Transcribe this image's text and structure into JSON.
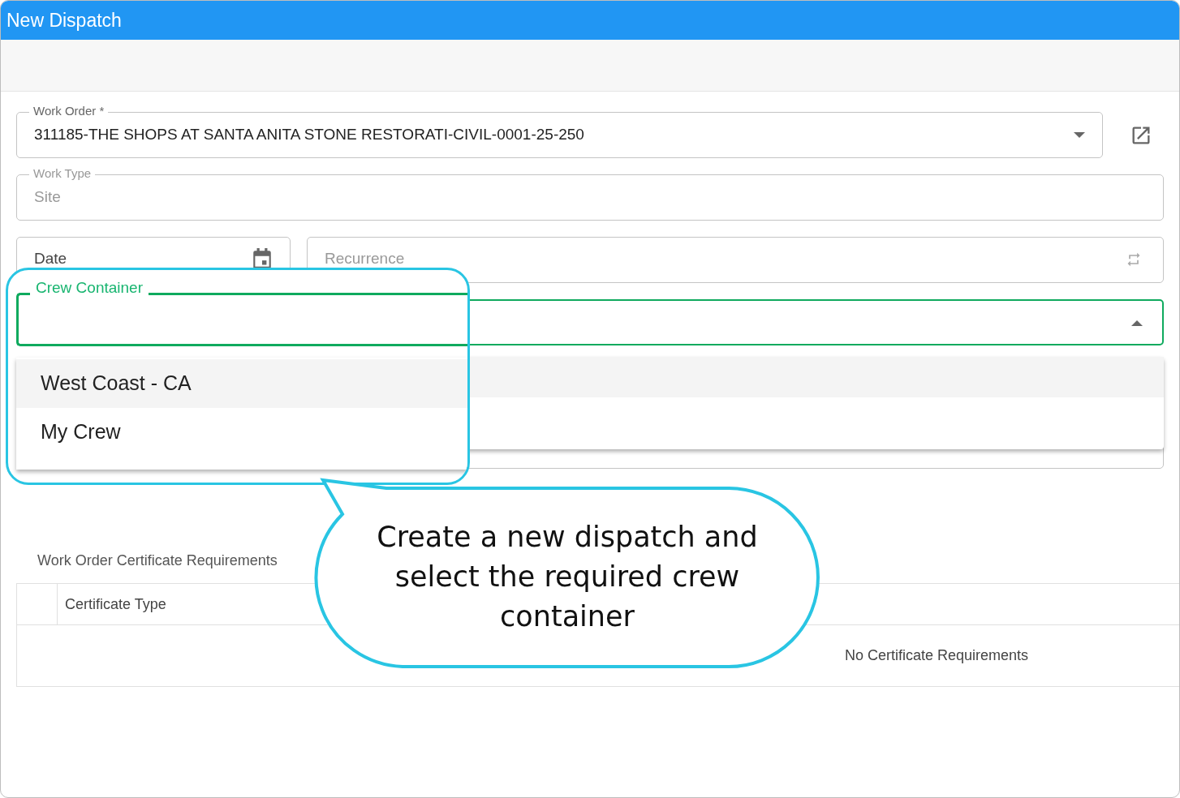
{
  "window": {
    "title": "New Dispatch"
  },
  "form": {
    "work_order": {
      "label": "Work Order *",
      "value": "311185-THE SHOPS AT SANTA ANITA STONE RESTORATI-CIVIL-0001-25-250"
    },
    "work_type": {
      "label": "Work Type",
      "value": "Site",
      "disabled": true
    },
    "date": {
      "label": "Date"
    },
    "recurrence": {
      "label": "Recurrence",
      "disabled": true
    },
    "crew_container": {
      "label": "Crew Container",
      "expanded": true,
      "options": [
        {
          "label": "West Coast - CA",
          "highlighted": true
        },
        {
          "label": "My Crew",
          "highlighted": false
        }
      ]
    }
  },
  "certificates": {
    "title": "Work Order Certificate Requirements",
    "columns": [
      "Certificate Type"
    ],
    "empty_text": "No Certificate Requirements"
  },
  "callout": {
    "text": "Create a new dispatch and select the required crew container"
  }
}
